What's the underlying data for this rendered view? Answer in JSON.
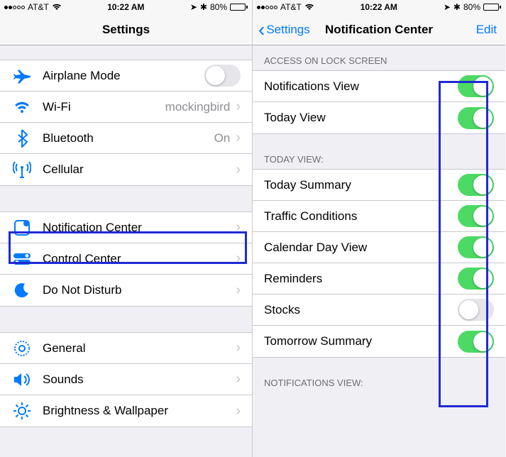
{
  "status": {
    "carrier": "AT&T",
    "time": "10:22 AM",
    "battery_pct": "80%"
  },
  "left": {
    "title": "Settings",
    "rows": {
      "airplane": "Airplane Mode",
      "wifi": "Wi-Fi",
      "wifi_value": "mockingbird",
      "bluetooth": "Bluetooth",
      "bluetooth_value": "On",
      "cellular": "Cellular",
      "notification": "Notification Center",
      "control": "Control Center",
      "dnd": "Do Not Disturb",
      "general": "General",
      "sounds": "Sounds",
      "brightness": "Brightness & Wallpaper"
    }
  },
  "right": {
    "back": "Settings",
    "title": "Notification Center",
    "edit": "Edit",
    "section_access": "ACCESS ON LOCK SCREEN",
    "section_today": "TODAY VIEW:",
    "section_notif": "NOTIFICATIONS VIEW:",
    "rows": {
      "notif_view": "Notifications View",
      "today_view": "Today View",
      "today_summary": "Today Summary",
      "traffic": "Traffic Conditions",
      "calendar": "Calendar Day View",
      "reminders": "Reminders",
      "stocks": "Stocks",
      "tomorrow": "Tomorrow Summary"
    }
  }
}
